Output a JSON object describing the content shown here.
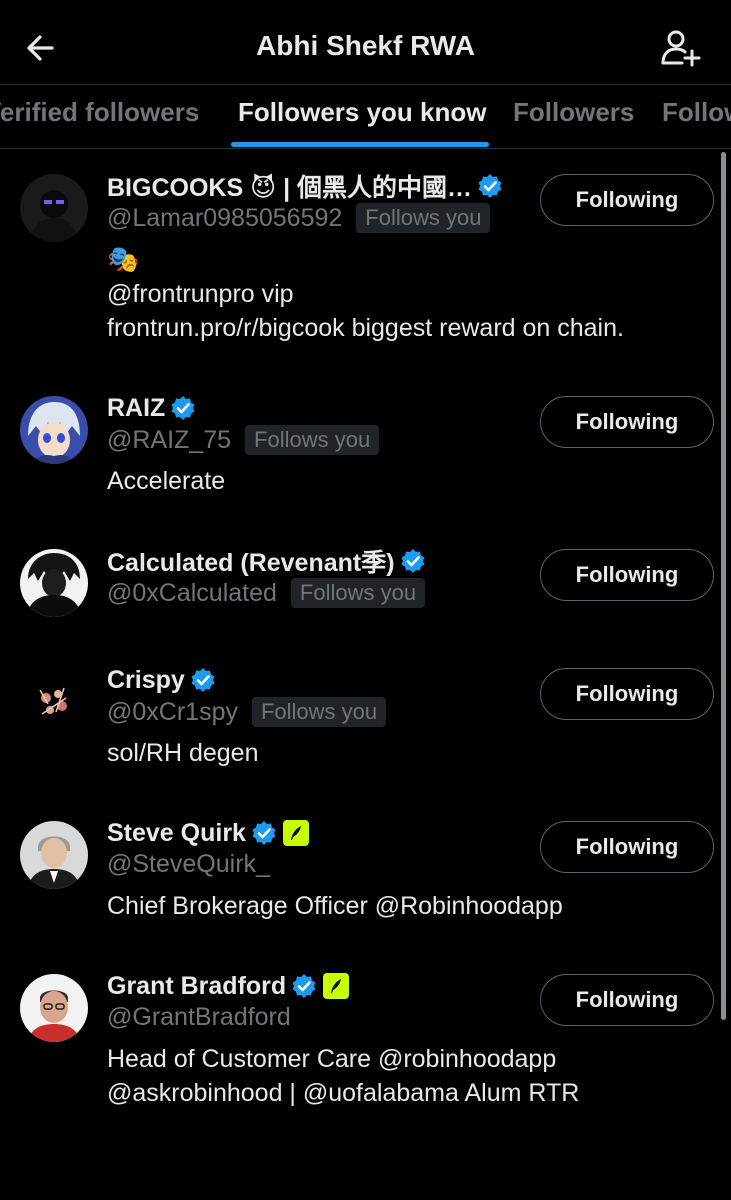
{
  "header": {
    "title": "Abhi Shekf RWA",
    "back_icon": "arrow-left-icon",
    "add_user_icon": "person-add-icon"
  },
  "tabs": [
    {
      "label": "Verified followers"
    },
    {
      "label": "Followers you know",
      "active": true
    },
    {
      "label": "Followers"
    },
    {
      "label": "Following"
    }
  ],
  "colors": {
    "accent": "#1d9bf0",
    "background": "#000000",
    "text_primary": "#e7e9ea",
    "text_secondary": "#71767b",
    "robinhood_badge": "#c8ff00"
  },
  "users": [
    {
      "name": "BIGCOOKS 😈 | 個黑人的中國…",
      "handle": "@Lamar0985056592",
      "follows_you": "Follows you",
      "verified": true,
      "bio_emoji": "🎭",
      "bio": [
        "@frontrunpro vip",
        "frontrun.pro/r/bigcook biggest reward on chain."
      ],
      "button": "Following"
    },
    {
      "name": "RAIZ",
      "handle": "@RAIZ_75",
      "follows_you": "Follows you",
      "verified": true,
      "bio": [
        "Accelerate"
      ],
      "button": "Following"
    },
    {
      "name": "Calculated (Revenant季)",
      "handle": "@0xCalculated",
      "follows_you": "Follows you",
      "verified": true,
      "bio": [],
      "button": "Following"
    },
    {
      "name": "Crispy",
      "handle": "@0xCr1spy",
      "follows_you": "Follows you",
      "verified": true,
      "bio": [
        "sol/RH degen"
      ],
      "button": "Following"
    },
    {
      "name": "Steve Quirk",
      "handle": "@SteveQuirk_",
      "verified": true,
      "affiliate_badge": "robinhood-feather-icon",
      "bio": [
        "Chief Brokerage Officer @Robinhoodapp"
      ],
      "button": "Following"
    },
    {
      "name": "Grant Bradford",
      "handle": "@GrantBradford",
      "verified": true,
      "affiliate_badge": "robinhood-feather-icon",
      "bio": [
        "Head of Customer Care @robinhoodapp",
        "@askrobinhood | @uofalabama Alum RTR"
      ],
      "button": "Following"
    }
  ]
}
